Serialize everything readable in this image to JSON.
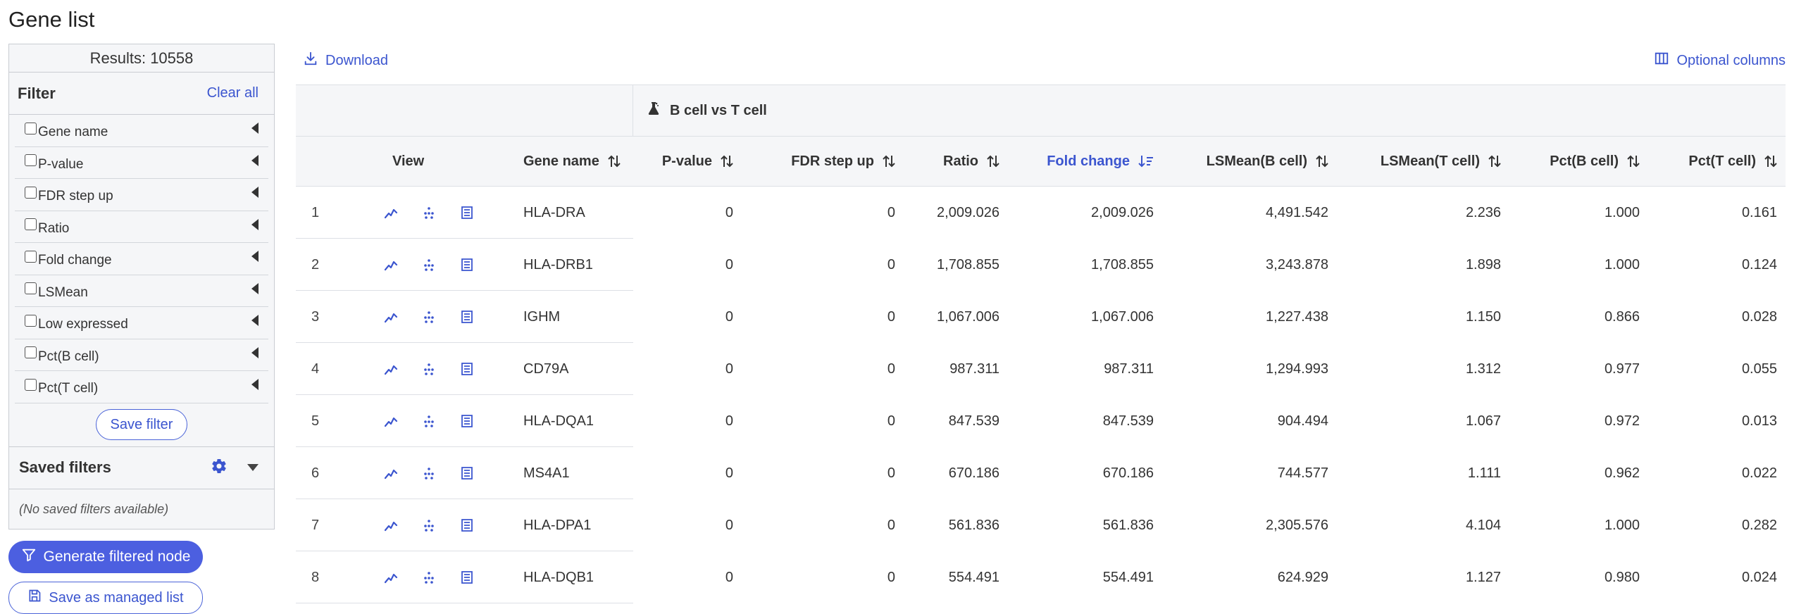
{
  "page": {
    "title": "Gene list"
  },
  "sidebar": {
    "results": "Results: 10558",
    "filter_title": "Filter",
    "clear_all": "Clear all",
    "filters": [
      "Gene name",
      "P-value",
      "FDR step up",
      "Ratio",
      "Fold change",
      "LSMean",
      "Low expressed",
      "Pct(B cell)",
      "Pct(T cell)"
    ],
    "save_filter": "Save filter",
    "saved_filters_title": "Saved filters",
    "no_saved": "(No saved filters available)"
  },
  "actions": {
    "generate": "Generate filtered node",
    "save_managed": "Save as managed list"
  },
  "toolbar": {
    "download": "Download",
    "optional_columns": "Optional columns"
  },
  "table": {
    "group_label": "B cell vs T cell",
    "columns": {
      "view": "View",
      "gene": "Gene name",
      "pvalue": "P-value",
      "fdr": "FDR step up",
      "ratio": "Ratio",
      "fold": "Fold change",
      "lsmean_b": "LSMean(B cell)",
      "lsmean_t": "LSMean(T cell)",
      "pct_b": "Pct(B cell)",
      "pct_t": "Pct(T cell)"
    },
    "rows": [
      {
        "idx": "1",
        "gene": "HLA-DRA",
        "p": "0",
        "fdr": "0",
        "ratio": "2,009.026",
        "fold": "2,009.026",
        "lb": "4,491.542",
        "lt": "2.236",
        "pb": "1.000",
        "pt": "0.161"
      },
      {
        "idx": "2",
        "gene": "HLA-DRB1",
        "p": "0",
        "fdr": "0",
        "ratio": "1,708.855",
        "fold": "1,708.855",
        "lb": "3,243.878",
        "lt": "1.898",
        "pb": "1.000",
        "pt": "0.124"
      },
      {
        "idx": "3",
        "gene": "IGHM",
        "p": "0",
        "fdr": "0",
        "ratio": "1,067.006",
        "fold": "1,067.006",
        "lb": "1,227.438",
        "lt": "1.150",
        "pb": "0.866",
        "pt": "0.028"
      },
      {
        "idx": "4",
        "gene": "CD79A",
        "p": "0",
        "fdr": "0",
        "ratio": "987.311",
        "fold": "987.311",
        "lb": "1,294.993",
        "lt": "1.312",
        "pb": "0.977",
        "pt": "0.055"
      },
      {
        "idx": "5",
        "gene": "HLA-DQA1",
        "p": "0",
        "fdr": "0",
        "ratio": "847.539",
        "fold": "847.539",
        "lb": "904.494",
        "lt": "1.067",
        "pb": "0.972",
        "pt": "0.013"
      },
      {
        "idx": "6",
        "gene": "MS4A1",
        "p": "0",
        "fdr": "0",
        "ratio": "670.186",
        "fold": "670.186",
        "lb": "744.577",
        "lt": "1.111",
        "pb": "0.962",
        "pt": "0.022"
      },
      {
        "idx": "7",
        "gene": "HLA-DPA1",
        "p": "0",
        "fdr": "0",
        "ratio": "561.836",
        "fold": "561.836",
        "lb": "2,305.576",
        "lt": "4.104",
        "pb": "1.000",
        "pt": "0.282"
      },
      {
        "idx": "8",
        "gene": "HLA-DQB1",
        "p": "0",
        "fdr": "0",
        "ratio": "554.491",
        "fold": "554.491",
        "lb": "624.929",
        "lt": "1.127",
        "pb": "0.980",
        "pt": "0.024"
      }
    ]
  },
  "icons": {
    "download": "download-icon",
    "optional_columns": "columns-icon",
    "group": "flask-icon",
    "sort": "sort-arrows-icon",
    "sort_desc": "sort-desc-icon",
    "view_row": [
      "line-plot-icon",
      "scatter-icon",
      "table-view-icon"
    ],
    "gear": "gear-icon",
    "filter": "filter-icon",
    "save": "save-icon"
  },
  "colors": {
    "accent": "#3b55cf",
    "primary_button": "#4c5fe0",
    "header_bg": "#f5f6f8",
    "border": "#c9ccd2"
  }
}
